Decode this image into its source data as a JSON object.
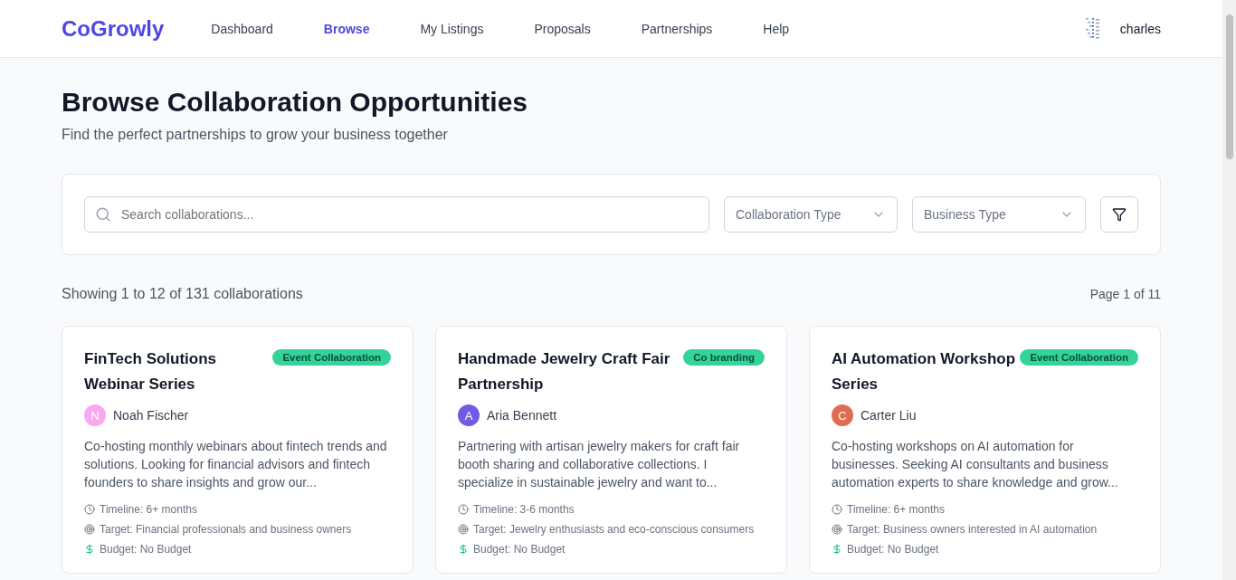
{
  "header": {
    "logo": "CoGrowly",
    "nav": [
      {
        "label": "Dashboard",
        "selected": false
      },
      {
        "label": "Browse",
        "selected": true
      },
      {
        "label": "My Listings",
        "selected": false
      },
      {
        "label": "Proposals",
        "selected": false
      },
      {
        "label": "Partnerships",
        "selected": false
      },
      {
        "label": "Help",
        "selected": false
      }
    ],
    "user": "charles"
  },
  "page": {
    "title": "Browse Collaboration Opportunities",
    "subtitle": "Find the perfect partnerships to grow your business together"
  },
  "filters": {
    "search": {
      "placeholder": "Search collaborations..."
    },
    "selects": [
      {
        "placeholder": "Collaboration Type"
      },
      {
        "placeholder": "Business Type"
      }
    ]
  },
  "results": {
    "summary": "Showing 1 to 12 of 131 collaborations",
    "page": "Page 1 of 11"
  },
  "cards": [
    {
      "title": "FinTech Solutions Webinar Series",
      "tag": "Event Collaboration",
      "initial": "N",
      "author": "Noah Fischer",
      "color": "#f9a8f0",
      "description": "Co-hosting monthly webinars about fintech trends and solutions. Looking for financial advisors and fintech founders to share insights and grow our...",
      "details": [
        {
          "kind": "timeline",
          "text": "Timeline: 6+ months"
        },
        {
          "kind": "target",
          "text": "Target: Financial professionals and business owners"
        },
        {
          "kind": "budget",
          "text": "Budget: No Budget"
        }
      ]
    },
    {
      "title": "Handmade Jewelry Craft Fair Partnership",
      "tag": "Co branding",
      "initial": "A",
      "author": "Aria Bennett",
      "color": "#6f5ce0",
      "description": "Partnering with artisan jewelry makers for craft fair booth sharing and collaborative collections. I specialize in sustainable jewelry and want to...",
      "details": [
        {
          "kind": "timeline",
          "text": "Timeline: 3-6 months"
        },
        {
          "kind": "target",
          "text": "Target: Jewelry enthusiasts and eco-conscious consumers"
        },
        {
          "kind": "budget",
          "text": "Budget: No Budget"
        }
      ]
    },
    {
      "title": "AI Automation Workshop Series",
      "tag": "Event Collaboration",
      "initial": "C",
      "author": "Carter Liu",
      "color": "#e06c52",
      "description": "Co-hosting workshops on AI automation for businesses. Seeking AI consultants and business automation experts to share knowledge and grow...",
      "details": [
        {
          "kind": "timeline",
          "text": "Timeline: 6+ months"
        },
        {
          "kind": "target",
          "text": "Target: Business owners interested in AI automation"
        },
        {
          "kind": "budget",
          "text": "Budget: No Budget"
        }
      ]
    }
  ]
}
